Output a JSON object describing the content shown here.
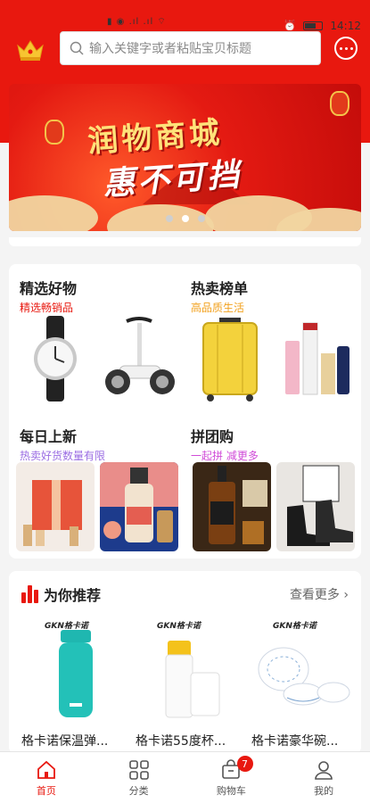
{
  "status_bar": {
    "time": "14:12",
    "left_glyphs": "▮ ◉ .ıl .ıl ⌔"
  },
  "search": {
    "placeholder": "输入关键字或者粘贴宝贝标题"
  },
  "banner": {
    "line1": "润物商城",
    "line2": "惠不可挡",
    "dots": 3,
    "active_dot": 1
  },
  "sections": [
    {
      "title": "精选好物",
      "subtitle": "精选畅销品",
      "subtitle_color": "#e8180f",
      "images": [
        "watch",
        "balance-scooter"
      ]
    },
    {
      "title": "热卖榜单",
      "subtitle": "高品质生活",
      "subtitle_color": "#f2a11e",
      "images": [
        "yellow-suitcase",
        "cosmetics"
      ]
    },
    {
      "title": "每日上新",
      "subtitle": "热卖好货数量有限",
      "subtitle_color": "#9b6de3",
      "images": [
        "gift-box",
        "drink-bottle"
      ]
    },
    {
      "title": "拼团购",
      "subtitle": "一起拼 减更多",
      "subtitle_color": "#d04bd8",
      "images": [
        "whisky",
        "black-boots"
      ]
    }
  ],
  "recommend": {
    "title": "为你推荐",
    "more": "查看更多",
    "brand_label": "GKN格卡诺",
    "items": [
      {
        "name": "格卡诺保温弹..."
      },
      {
        "name": "格卡诺55度杯..."
      },
      {
        "name": "格卡诺豪华碗..."
      }
    ]
  },
  "tabs": [
    {
      "label": "首页",
      "icon": "home-icon",
      "active": true
    },
    {
      "label": "分类",
      "icon": "grid-icon",
      "active": false
    },
    {
      "label": "购物车",
      "icon": "cart-icon",
      "active": false,
      "badge": "7"
    },
    {
      "label": "我的",
      "icon": "user-icon",
      "active": false
    }
  ],
  "colors": {
    "brand_red": "#e8180f"
  }
}
